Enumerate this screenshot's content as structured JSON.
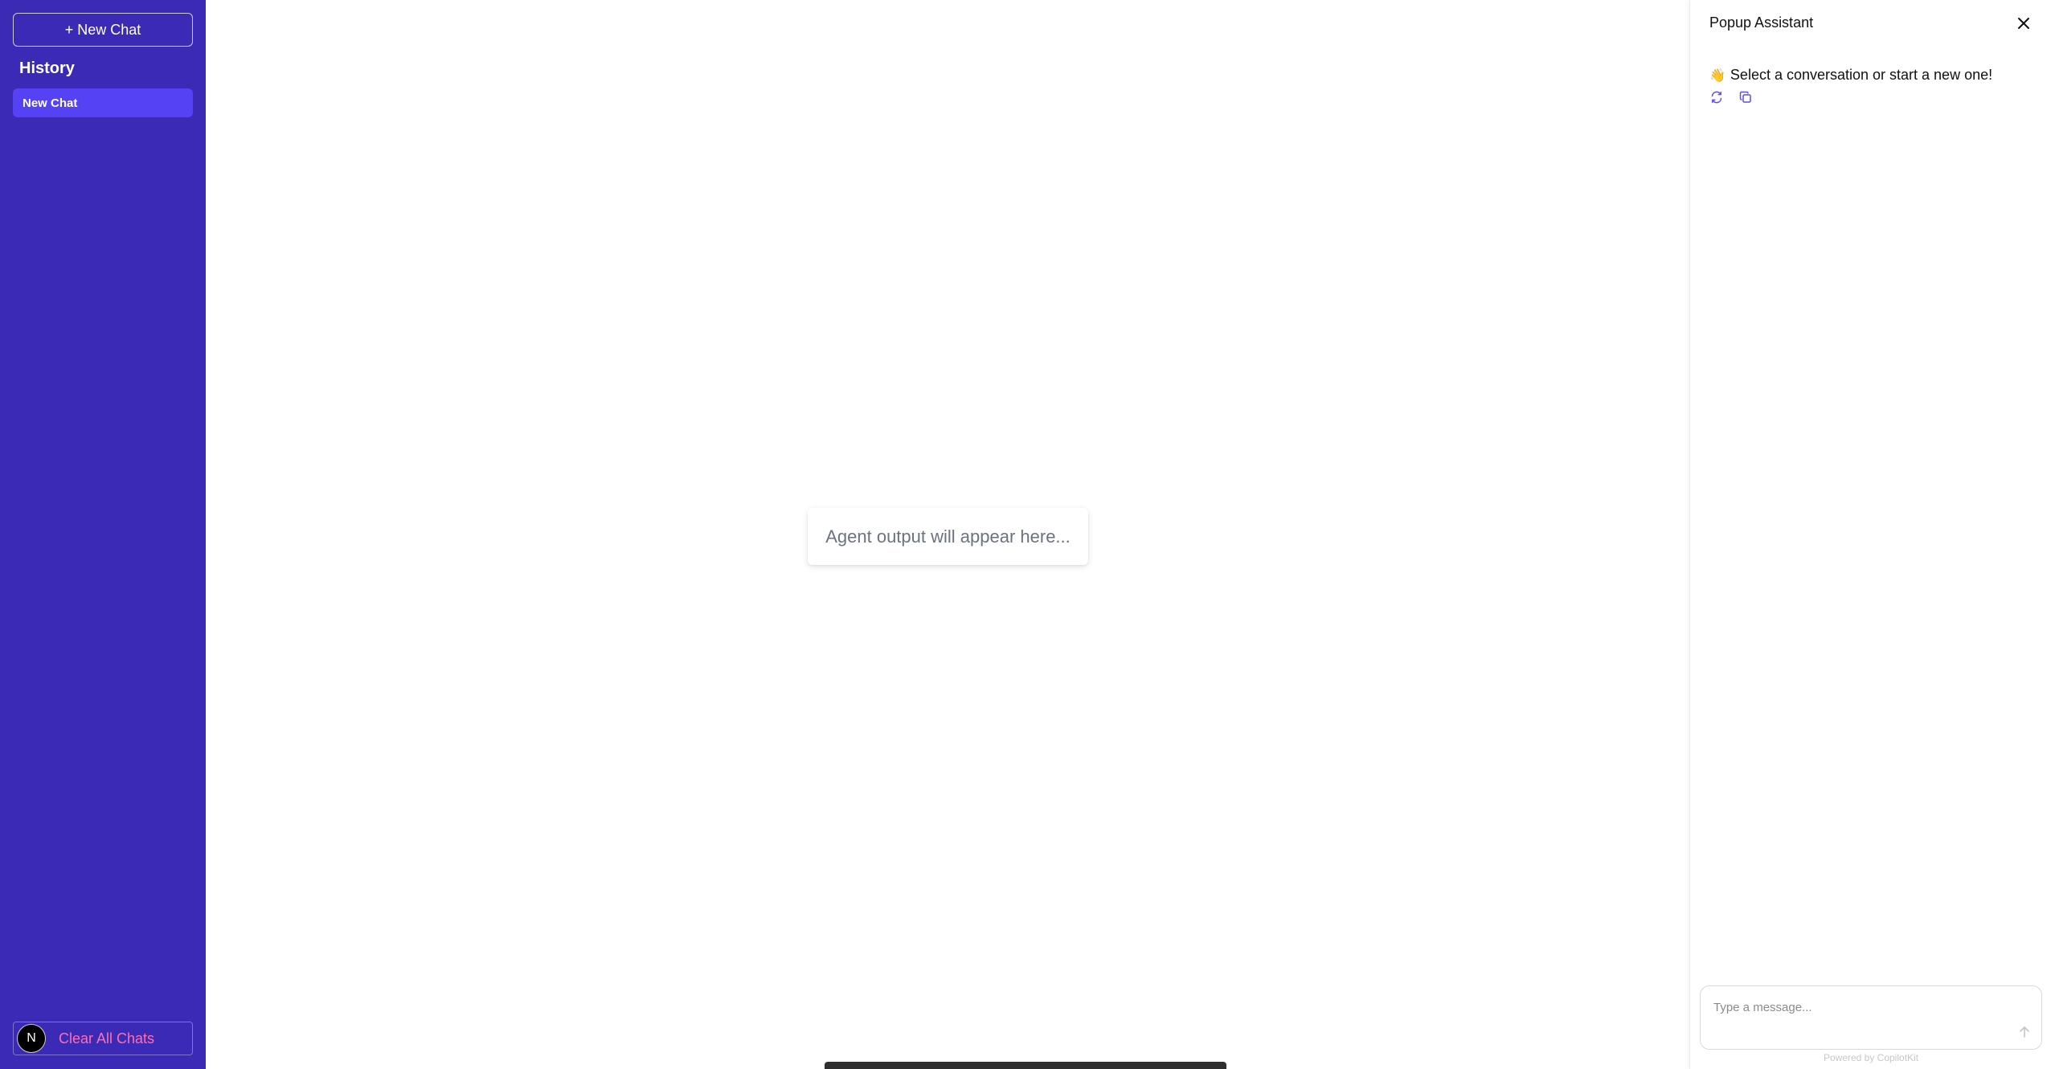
{
  "sidebar": {
    "new_chat_label": "+ New Chat",
    "history_title": "History",
    "history_items": [
      {
        "label": "New Chat"
      }
    ],
    "avatar_letter": "N",
    "clear_label": "Clear All Chats"
  },
  "main": {
    "output_placeholder": "Agent output will appear here..."
  },
  "popup": {
    "title": "Popup Assistant",
    "welcome_emoji": "👋",
    "welcome_text": "Select a conversation or start a new one!",
    "input_placeholder": "Type a message...",
    "powered_by": "Powered by CopilotKit"
  },
  "icons": {
    "close": "close-icon",
    "regenerate": "refresh-icon",
    "copy": "copy-icon",
    "send": "arrow-up-icon"
  },
  "colors": {
    "sidebar_bg": "#3b2ab5",
    "active_item_bg": "#5542f5",
    "clear_text": "#ff6fb0",
    "accent_icon": "#5b4cf0"
  }
}
